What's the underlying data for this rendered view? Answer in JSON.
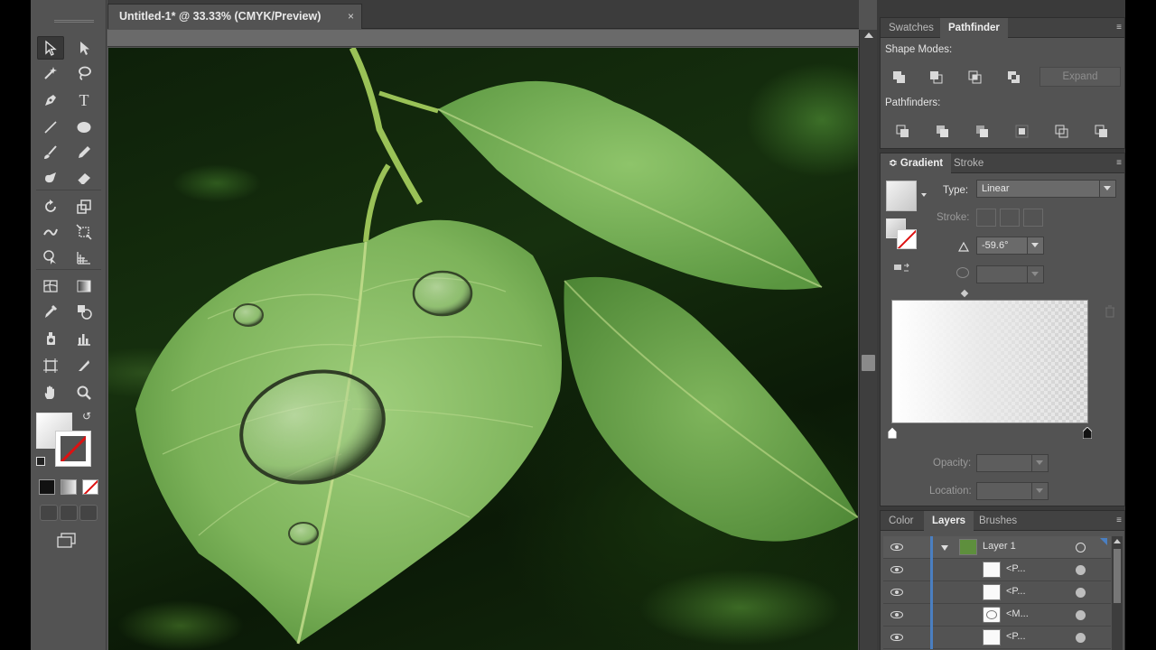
{
  "document": {
    "tab_title": "Untitled-1* @ 33.33% (CMYK/Preview)",
    "tab_close": "×"
  },
  "toolbar": {
    "tools": [
      {
        "name": "selection-tool",
        "icon": "arrow-icon",
        "active": true
      },
      {
        "name": "direct-selection-tool",
        "icon": "hollow-arrow-icon"
      },
      {
        "name": "magic-wand-tool",
        "icon": "magic-wand-icon"
      },
      {
        "name": "lasso-tool",
        "icon": "lasso-icon"
      },
      {
        "name": "pen-tool",
        "icon": "pen-icon"
      },
      {
        "name": "type-tool",
        "icon": "type-icon",
        "glyph": "T"
      },
      {
        "name": "line-tool",
        "icon": "line-icon"
      },
      {
        "name": "ellipse-tool",
        "icon": "ellipse-icon"
      },
      {
        "name": "paintbrush-tool",
        "icon": "brush-icon"
      },
      {
        "name": "pencil-tool",
        "icon": "pencil-icon"
      },
      {
        "name": "blob-brush-tool",
        "icon": "blob-brush-icon"
      },
      {
        "name": "eraser-tool",
        "icon": "eraser-icon"
      },
      {
        "name": "rotate-tool",
        "icon": "rotate-icon"
      },
      {
        "name": "scale-tool",
        "icon": "scale-icon"
      },
      {
        "name": "warp-tool",
        "icon": "warp-icon"
      },
      {
        "name": "free-transform-tool",
        "icon": "free-transform-icon"
      },
      {
        "name": "shape-builder-tool",
        "icon": "shape-builder-icon"
      },
      {
        "name": "perspective-grid-tool",
        "icon": "perspective-grid-icon"
      },
      {
        "name": "mesh-tool",
        "icon": "mesh-icon"
      },
      {
        "name": "gradient-tool",
        "icon": "gradient-icon"
      },
      {
        "name": "eyedropper-tool",
        "icon": "eyedropper-icon"
      },
      {
        "name": "blend-tool",
        "icon": "blend-icon"
      },
      {
        "name": "symbol-sprayer-tool",
        "icon": "symbol-sprayer-icon"
      },
      {
        "name": "column-graph-tool",
        "icon": "column-graph-icon"
      },
      {
        "name": "artboard-tool",
        "icon": "artboard-icon"
      },
      {
        "name": "slice-tool",
        "icon": "knife-icon"
      },
      {
        "name": "hand-tool",
        "icon": "hand-icon"
      },
      {
        "name": "zoom-tool",
        "icon": "zoom-icon"
      }
    ],
    "swap_symbol": "↺"
  },
  "pathfinder_panel": {
    "tabs": [
      "Swatches",
      "Pathfinder"
    ],
    "active_tab": "Pathfinder",
    "shape_modes_label": "Shape Modes:",
    "pathfinders_label": "Pathfinders:",
    "expand_label": "Expand",
    "menu_icon": "≡"
  },
  "gradient_panel": {
    "tabs": [
      "Gradient",
      "Stroke"
    ],
    "active_tab": "Gradient",
    "tab_prefix": "≎",
    "type_label": "Type:",
    "type_value": "Linear",
    "stroke_label": "Stroke:",
    "angle_value": "-59.6°",
    "opacity_label": "Opacity:",
    "location_label": "Location:",
    "menu_icon": "≡"
  },
  "layers_panel": {
    "tabs": [
      "Color",
      "Layers",
      "Brushes"
    ],
    "active_tab": "Layers",
    "menu_icon": "≡",
    "rows": [
      {
        "name": "Layer 1",
        "is_layer": true
      },
      {
        "name": "<P..."
      },
      {
        "name": "<P..."
      },
      {
        "name": "<M..."
      },
      {
        "name": "<P..."
      }
    ]
  },
  "colors": {
    "ui_bg": "#535353",
    "layer_color": "#4a7fc1",
    "leaf_green": "#7db35a"
  }
}
